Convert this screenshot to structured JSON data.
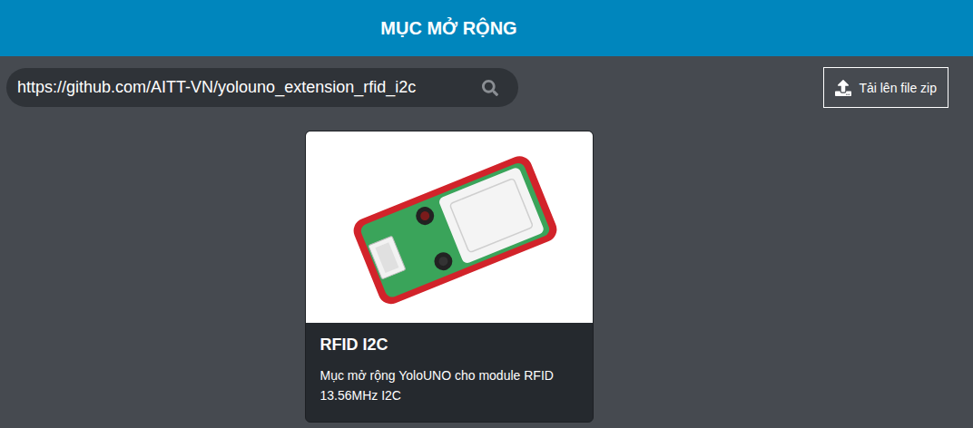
{
  "header": {
    "title": "MỤC MỞ RỘNG"
  },
  "search": {
    "value": "https://github.com/AITT-VN/yolouno_extension_rfid_i2c"
  },
  "upload_button": {
    "label": "Tải lên file zip"
  },
  "cards": [
    {
      "title": "RFID I2C",
      "description": "Mục mở rộng YoloUNO cho module RFID 13.56MHz I2C"
    }
  ]
}
